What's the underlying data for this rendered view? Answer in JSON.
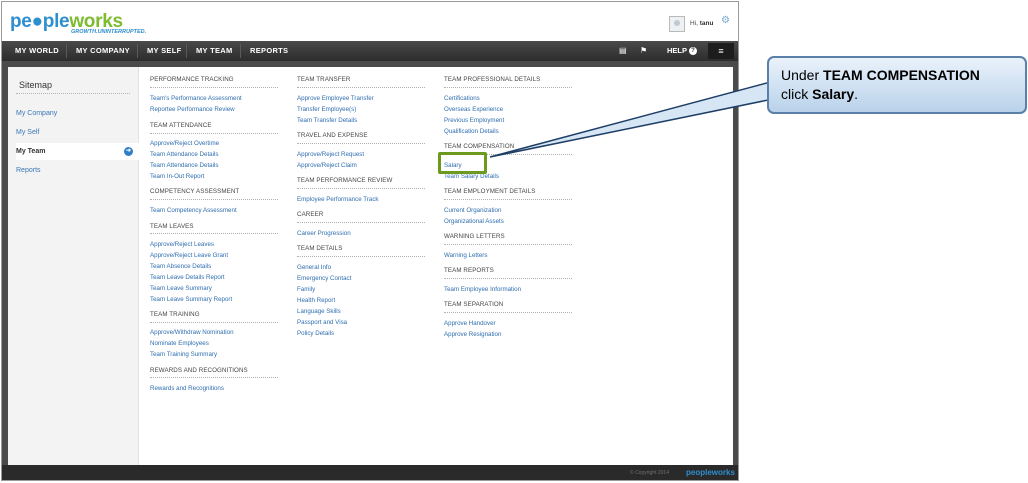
{
  "header": {
    "logo_part1": "pe",
    "logo_part2": "ple",
    "logo_part3": "works",
    "tagline": "GROWTH.UNINTERRUPTED.",
    "greeting_prefix": "Hi,",
    "greeting_user": "tanu"
  },
  "nav": {
    "items": [
      "MY WORLD",
      "MY COMPANY",
      "MY SELF",
      "MY TEAM",
      "REPORTS"
    ],
    "help": "HELP"
  },
  "sidebar": {
    "title": "Sitemap",
    "items": [
      "My Company",
      "My Self",
      "My Team",
      "Reports"
    ],
    "active_index": 2
  },
  "columns": [
    {
      "sections": [
        {
          "title": "PERFORMANCE TRACKING",
          "links": [
            "Team's Performance Assessment",
            "Reportee Performance Review"
          ]
        },
        {
          "title": "TEAM ATTENDANCE",
          "links": [
            "Approve/Reject Overtime",
            "Team Attendance Details",
            "Team Attendance Details",
            "Team In-Out Report"
          ]
        },
        {
          "title": "COMPETENCY ASSESSMENT",
          "links": [
            "Team Competency Assessment"
          ]
        },
        {
          "title": "TEAM LEAVES",
          "links": [
            "Approve/Reject Leaves",
            "Approve/Reject Leave Grant",
            "Team Absence Details",
            "Team Leave Details Report",
            "Team Leave Summary",
            "Team Leave Summary Report"
          ]
        },
        {
          "title": "TEAM TRAINING",
          "links": [
            "Approve/Withdraw Nomination",
            "Nominate Employees",
            "Team Training Summary"
          ]
        },
        {
          "title": "REWARDS AND RECOGNITIONS",
          "links": [
            "Rewards and Recognitions"
          ]
        }
      ]
    },
    {
      "sections": [
        {
          "title": "TEAM TRANSFER",
          "links": [
            "Approve Employee Transfer",
            "Transfer Employee(s)",
            "Team Transfer Details"
          ]
        },
        {
          "title": "TRAVEL AND EXPENSE",
          "links": [
            "Approve/Reject Request",
            "Approve/Reject Claim"
          ]
        },
        {
          "title": "TEAM PERFORMANCE REVIEW",
          "links": [
            "Employee Performance Track"
          ]
        },
        {
          "title": "CAREER",
          "links": [
            "Career Progression"
          ]
        },
        {
          "title": "TEAM DETAILS",
          "links": [
            "General Info",
            "Emergency Contact",
            "Family",
            "Health Report",
            "Language Skills",
            "Passport and Visa",
            "Policy Details"
          ]
        }
      ]
    },
    {
      "sections": [
        {
          "title": "TEAM PROFESSIONAL DETAILS",
          "links": [
            "Certifications",
            "Overseas Experience",
            "Previous Employment",
            "Qualification Details"
          ]
        },
        {
          "title": "TEAM COMPENSATION",
          "links": [
            "Salary",
            "Team Salary Details"
          ]
        },
        {
          "title": "TEAM EMPLOYMENT DETAILS",
          "links": [
            "Current Organization",
            "Organizational Assets"
          ]
        },
        {
          "title": "WARNING LETTERS",
          "links": [
            "Warning Letters"
          ]
        },
        {
          "title": "TEAM REPORTS",
          "links": [
            "Team Employee Information"
          ]
        },
        {
          "title": "TEAM SEPARATION",
          "links": [
            "Approve Handover",
            "Approve Resignation"
          ]
        }
      ]
    }
  ],
  "footer": {
    "copyright": "© Copyright 2014",
    "logo": "peopleworks"
  },
  "callout": {
    "prefix": "Under ",
    "bold1": "TEAM COMPENSATION",
    "mid": " click ",
    "bold2": "Salary",
    "suffix": "."
  },
  "colors": {
    "brand_blue": "#2e8fcf",
    "brand_green": "#7dbb2f",
    "link": "#2f6eb0",
    "highlight": "#6c9a1f"
  }
}
